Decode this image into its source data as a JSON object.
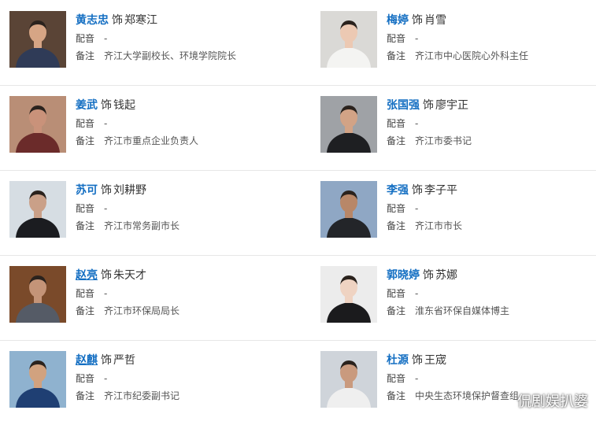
{
  "labels": {
    "as": "饰",
    "dub": "配音",
    "note": "备注"
  },
  "cast": [
    {
      "actor": "黄志忠",
      "role": "郑寒江",
      "dub": "-",
      "note": "齐江大学副校长、环境学院院长",
      "bg": "#5a4436",
      "shirt": "#2f3b57",
      "skin": "#d6a585"
    },
    {
      "actor": "梅婷",
      "role": "肖雪",
      "dub": "-",
      "note": "齐江市中心医院心外科主任",
      "bg": "#dad9d6",
      "shirt": "#f4f4f2",
      "skin": "#ecc9b3"
    },
    {
      "actor": "姜武",
      "role": "钱起",
      "dub": "-",
      "note": "齐江市重点企业负责人",
      "bg": "#b98e76",
      "shirt": "#6b2b2a",
      "skin": "#c9927a"
    },
    {
      "actor": "张国强",
      "role": "廖宇正",
      "dub": "-",
      "note": "齐江市委书记",
      "bg": "#9fa2a6",
      "shirt": "#1e1f22",
      "skin": "#d2a386"
    },
    {
      "actor": "苏可",
      "role": "刘耕野",
      "dub": "-",
      "note": "齐江市常务副市长",
      "bg": "#d6dde3",
      "shirt": "#1b1c20",
      "skin": "#caa088"
    },
    {
      "actor": "李强",
      "role": "李子平",
      "dub": "-",
      "note": "齐江市市长",
      "bg": "#8fa7c4",
      "shirt": "#232529",
      "skin": "#b88768"
    },
    {
      "actor": "赵亮",
      "role": "朱天才",
      "dub": "-",
      "note": "齐江市环保局局长",
      "bg": "#7a4a2a",
      "shirt": "#555b66",
      "skin": "#c49478"
    },
    {
      "actor": "郭晓婷",
      "role": "苏娜",
      "dub": "-",
      "note": "淮东省环保自媒体博主",
      "bg": "#ececec",
      "shirt": "#1b1b1d",
      "skin": "#efd3c2"
    },
    {
      "actor": "赵麒",
      "role": "严哲",
      "dub": "-",
      "note": "齐江市纪委副书记",
      "bg": "#8fb2cf",
      "shirt": "#1f3f73",
      "skin": "#d1a27f"
    },
    {
      "actor": "杜源",
      "role": "王宬",
      "dub": "-",
      "note": "中央生态环境保护督查组",
      "bg": "#cfd4da",
      "shirt": "#efefef",
      "skin": "#c99a7e"
    }
  ],
  "watermark": "侃剧娱扒婆"
}
